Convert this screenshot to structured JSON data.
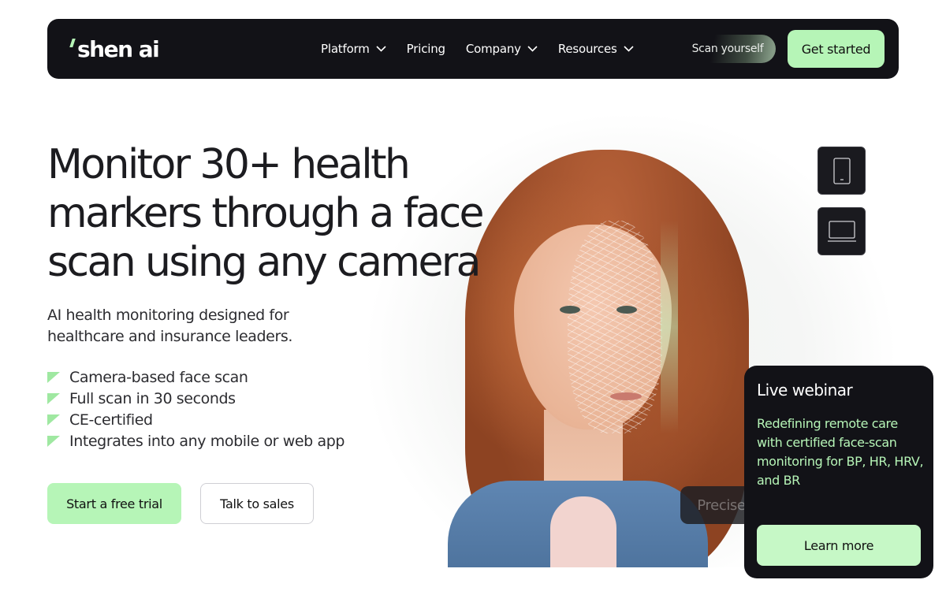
{
  "nav": {
    "logo_text": "shen ai",
    "links": [
      {
        "label": "Platform",
        "has_dropdown": true
      },
      {
        "label": "Pricing",
        "has_dropdown": false
      },
      {
        "label": "Company",
        "has_dropdown": true
      },
      {
        "label": "Resources",
        "has_dropdown": true
      }
    ],
    "scan_label": "Scan yourself",
    "cta_label": "Get started"
  },
  "hero": {
    "title": "Monitor 30+ health markers through a face scan using any camera",
    "subtitle": "AI health monitoring designed for healthcare and insurance leaders.",
    "features": [
      "Camera-based face scan",
      "Full scan in 30 seconds",
      "CE-certified",
      "Integrates into any mobile or web app"
    ],
    "primary_cta": "Start a free trial",
    "secondary_cta": "Talk to sales"
  },
  "visual": {
    "devices": [
      "phone-icon",
      "laptop-icon"
    ],
    "caption": "Precise facial mapping"
  },
  "webinar": {
    "title": "Live webinar",
    "description": "Redefining remote care with certified face-scan monitoring for BP, HR, HRV, and BR",
    "cta": "Learn more"
  },
  "colors": {
    "accent": "#b6f5b7",
    "dark": "#121217",
    "text": "#1c1c20"
  }
}
